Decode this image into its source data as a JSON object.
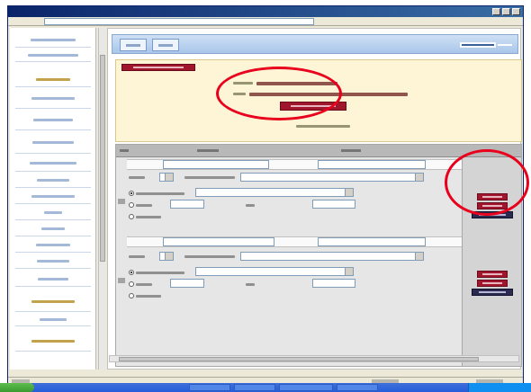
{
  "colors": {
    "window_frame": "#0a246a",
    "sidebar_link": "#5a7fb8",
    "sidebar_section": "#b38b1e",
    "panel_bg": "#fdf5d6",
    "red_button": "#a0162c",
    "navy_button": "#2b2b4f",
    "grid_bg": "#e6e6e6",
    "annotation": "#e8001c"
  },
  "icons": {
    "title_buttons": [
      "minimize-icon",
      "maximize-icon",
      "close-icon"
    ],
    "start": "windows-logo-icon",
    "combo": "chevron-down-icon"
  }
}
